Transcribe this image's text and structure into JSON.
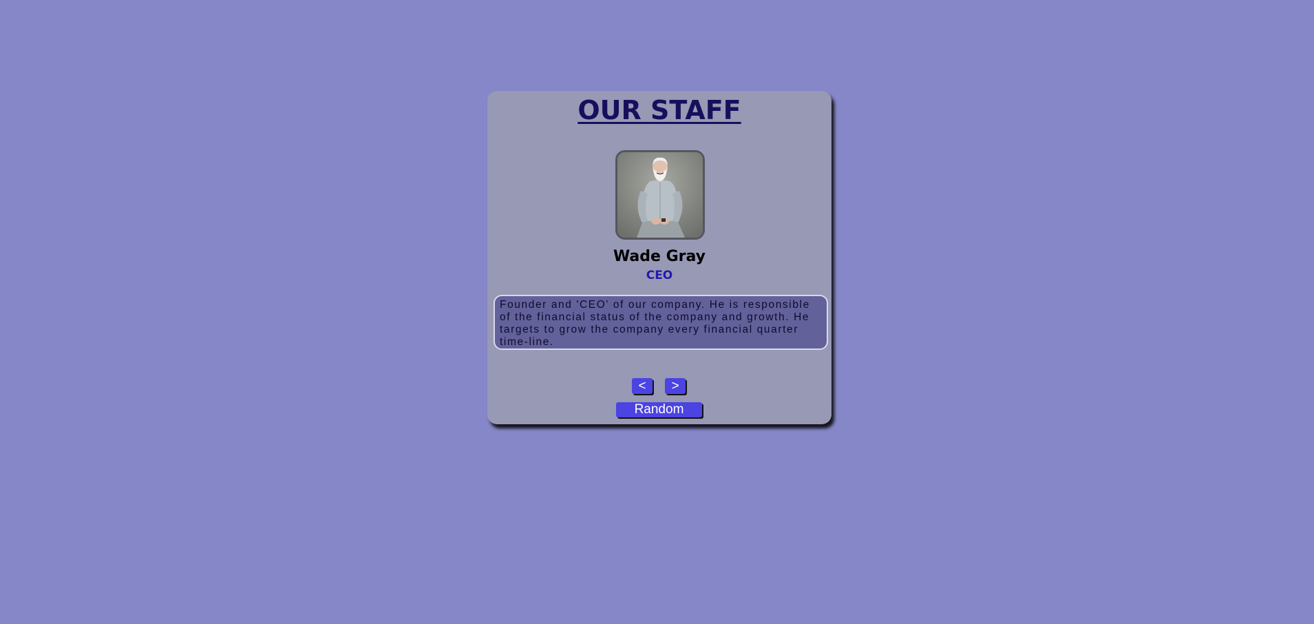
{
  "header": {
    "title": "OUR STAFF"
  },
  "person": {
    "photo_icon": "portrait-photo",
    "name": "Wade Gray",
    "role": "CEO",
    "bio": "Founder and 'CEO' of our company. He is responsible of the financial status of the company and growth. He targets to grow the company every financial quarter time-line."
  },
  "controls": {
    "prev_label": "<",
    "next_label": ">",
    "random_label": "Random"
  },
  "colors": {
    "background": "#8587c8",
    "card": "#9799b5",
    "title": "#180f5c",
    "role": "#2419b0",
    "bio_bg": "#63619a",
    "button": "#4b43e2"
  }
}
